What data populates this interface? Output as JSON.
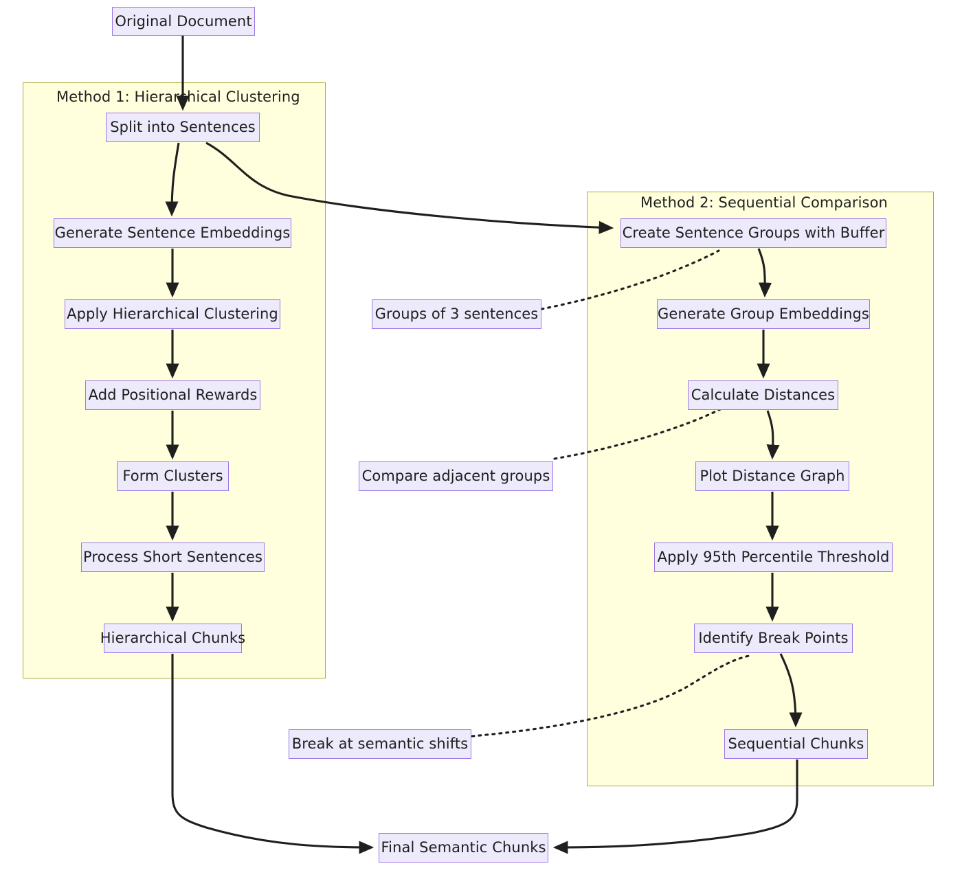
{
  "diagram": {
    "title": "Semantic Chunking Methods Flowchart",
    "colors": {
      "node_fill": "#eceafb",
      "node_border": "#9d77e8",
      "cluster_fill": "#ffffde",
      "cluster_border": "#aaaa33",
      "edge": "#1f1f1f",
      "text": "#1f1f1f"
    },
    "clusters": [
      {
        "id": "method1",
        "label": "Method 1: Hierarchical Clustering"
      },
      {
        "id": "method2",
        "label": "Method 2: Sequential Comparison"
      }
    ],
    "nodes": [
      {
        "id": "original-document",
        "label": "Original Document"
      },
      {
        "id": "split-into-sentences",
        "label": "Split into Sentences"
      },
      {
        "id": "generate-sentence-embeddings",
        "label": "Generate Sentence Embeddings"
      },
      {
        "id": "apply-hierarchical-clustering",
        "label": "Apply Hierarchical Clustering"
      },
      {
        "id": "add-positional-rewards",
        "label": "Add Positional Rewards"
      },
      {
        "id": "form-clusters",
        "label": "Form Clusters"
      },
      {
        "id": "process-short-sentences",
        "label": "Process Short Sentences"
      },
      {
        "id": "hierarchical-chunks",
        "label": "Hierarchical Chunks"
      },
      {
        "id": "create-sentence-groups-with-buffer",
        "label": "Create Sentence Groups with Buffer"
      },
      {
        "id": "generate-group-embeddings",
        "label": "Generate Group Embeddings"
      },
      {
        "id": "calculate-distances",
        "label": "Calculate Distances"
      },
      {
        "id": "plot-distance-graph",
        "label": "Plot Distance Graph"
      },
      {
        "id": "apply-95th-percentile-threshold",
        "label": "Apply 95th Percentile Threshold"
      },
      {
        "id": "identify-break-points",
        "label": "Identify Break Points"
      },
      {
        "id": "sequential-chunks",
        "label": "Sequential Chunks"
      },
      {
        "id": "groups-of-3-sentences",
        "label": "Groups of 3 sentences"
      },
      {
        "id": "compare-adjacent-groups",
        "label": "Compare adjacent groups"
      },
      {
        "id": "break-at-semantic-shifts",
        "label": "Break at semantic shifts"
      },
      {
        "id": "final-semantic-chunks",
        "label": "Final Semantic Chunks"
      }
    ],
    "edges": [
      {
        "from": "original-document",
        "to": "split-into-sentences",
        "style": "solid"
      },
      {
        "from": "split-into-sentences",
        "to": "generate-sentence-embeddings",
        "style": "solid"
      },
      {
        "from": "generate-sentence-embeddings",
        "to": "apply-hierarchical-clustering",
        "style": "solid"
      },
      {
        "from": "apply-hierarchical-clustering",
        "to": "add-positional-rewards",
        "style": "solid"
      },
      {
        "from": "add-positional-rewards",
        "to": "form-clusters",
        "style": "solid"
      },
      {
        "from": "form-clusters",
        "to": "process-short-sentences",
        "style": "solid"
      },
      {
        "from": "process-short-sentences",
        "to": "hierarchical-chunks",
        "style": "solid"
      },
      {
        "from": "split-into-sentences",
        "to": "create-sentence-groups-with-buffer",
        "style": "solid"
      },
      {
        "from": "create-sentence-groups-with-buffer",
        "to": "generate-group-embeddings",
        "style": "solid"
      },
      {
        "from": "generate-group-embeddings",
        "to": "calculate-distances",
        "style": "solid"
      },
      {
        "from": "calculate-distances",
        "to": "plot-distance-graph",
        "style": "solid"
      },
      {
        "from": "plot-distance-graph",
        "to": "apply-95th-percentile-threshold",
        "style": "solid"
      },
      {
        "from": "apply-95th-percentile-threshold",
        "to": "identify-break-points",
        "style": "solid"
      },
      {
        "from": "identify-break-points",
        "to": "sequential-chunks",
        "style": "solid"
      },
      {
        "from": "hierarchical-chunks",
        "to": "final-semantic-chunks",
        "style": "solid"
      },
      {
        "from": "sequential-chunks",
        "to": "final-semantic-chunks",
        "style": "solid"
      },
      {
        "from": "groups-of-3-sentences",
        "to": "create-sentence-groups-with-buffer",
        "style": "dotted"
      },
      {
        "from": "compare-adjacent-groups",
        "to": "calculate-distances",
        "style": "dotted"
      },
      {
        "from": "break-at-semantic-shifts",
        "to": "identify-break-points",
        "style": "dotted"
      }
    ]
  }
}
